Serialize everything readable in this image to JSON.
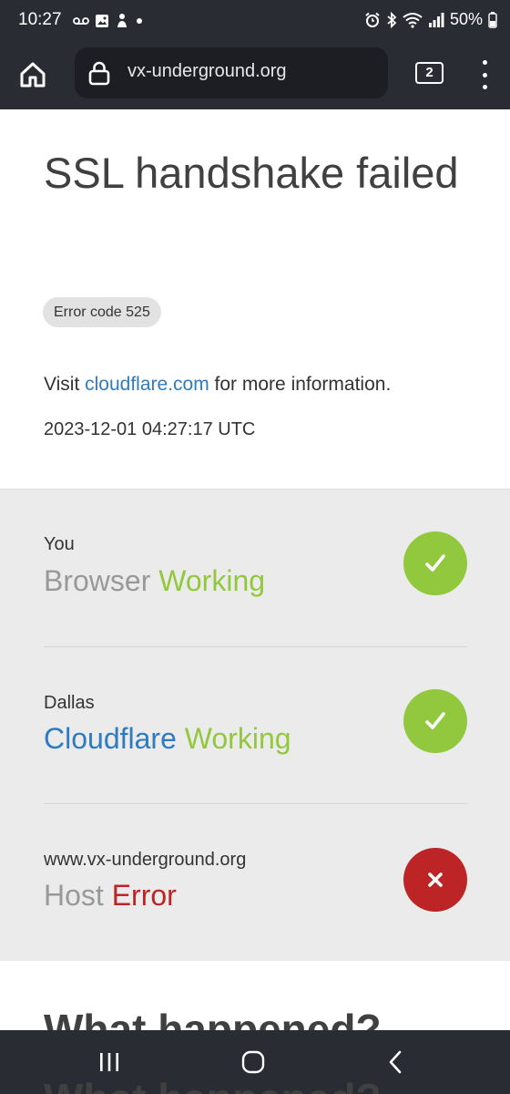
{
  "status_bar": {
    "time": "10:27",
    "left_icons": [
      "voicemail-icon",
      "gallery-icon",
      "notification-icon",
      "dot-icon"
    ],
    "right_icons": [
      "alarm-icon",
      "bluetooth-icon",
      "wifi-icon",
      "signal-icon"
    ],
    "battery": "50%"
  },
  "browser": {
    "url": "vx-underground.org",
    "tab_count": "2"
  },
  "page": {
    "title": "SSL handshake failed",
    "error_code": "Error code 525",
    "visit_prefix": "Visit",
    "visit_link": "cloudflare.com",
    "visit_suffix": "for more information.",
    "timestamp": "2023-12-01 04:27:17 UTC",
    "status_rows": [
      {
        "location": "You",
        "name": "Browser",
        "status": "Working",
        "state": "ok"
      },
      {
        "location": "Dallas",
        "name": "Cloudflare",
        "status": "Working",
        "state": "ok"
      },
      {
        "location": "www.vx-underground.org",
        "name": "Host",
        "status": "Error",
        "state": "error"
      }
    ],
    "what_happened": "What happened?"
  },
  "colors": {
    "ok_green": "#92c83e",
    "error_red": "#bd2426",
    "link_blue": "#2f7bbf",
    "chrome_dark": "#2a2c33"
  },
  "nav_bar": {
    "buttons": [
      "recents-icon",
      "home-circle-icon",
      "back-icon"
    ]
  }
}
